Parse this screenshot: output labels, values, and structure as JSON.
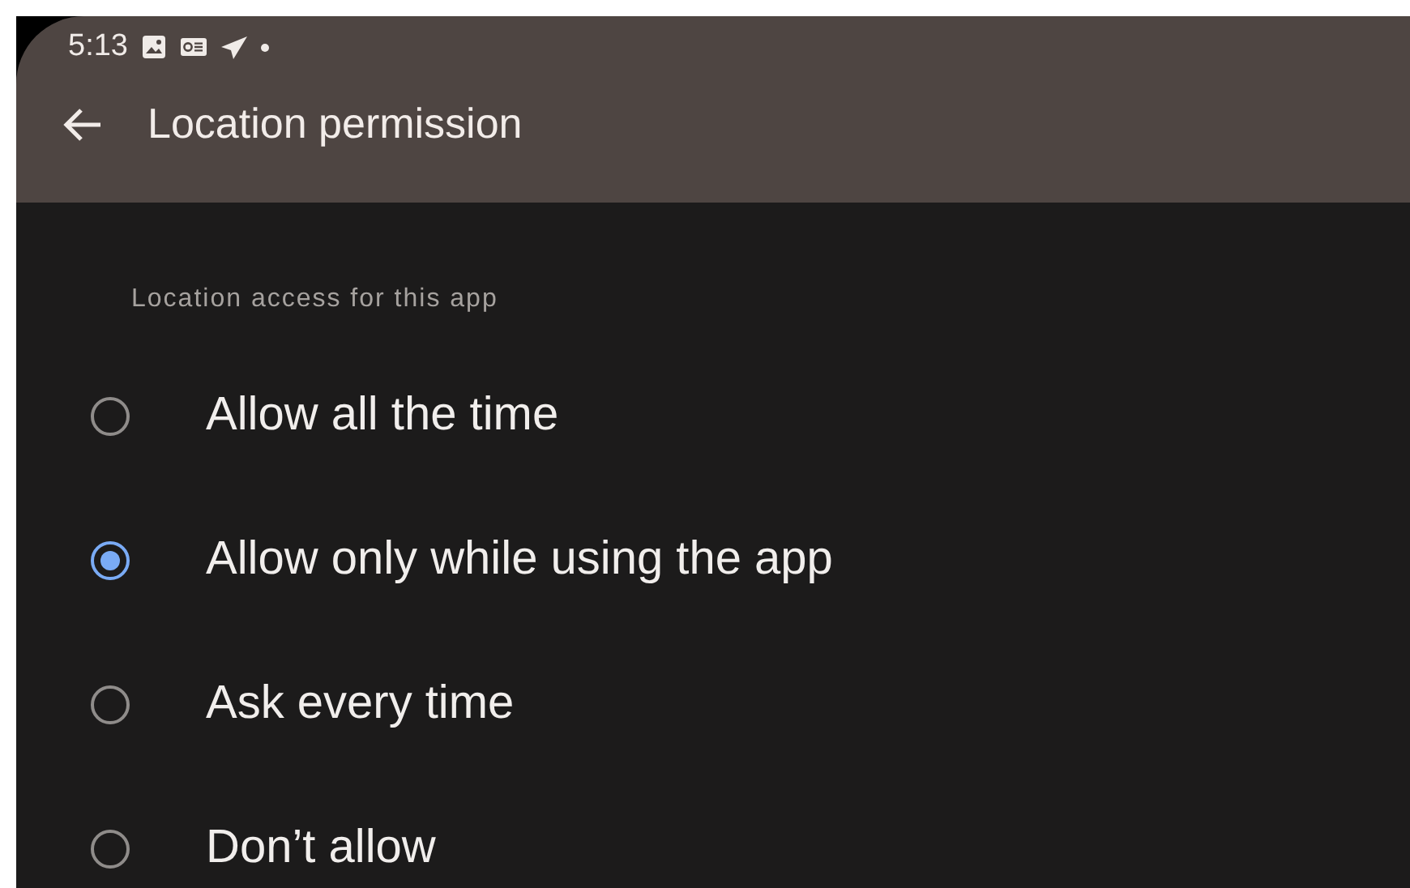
{
  "status_bar": {
    "time": "5:13"
  },
  "app_bar": {
    "title": "Location permission"
  },
  "section": {
    "title": "Location access for this app"
  },
  "options": [
    {
      "label": "Allow all the time",
      "selected": false
    },
    {
      "label": "Allow only while using the app",
      "selected": true
    },
    {
      "label": "Ask every time",
      "selected": false
    },
    {
      "label": "Don’t allow",
      "selected": false
    }
  ]
}
